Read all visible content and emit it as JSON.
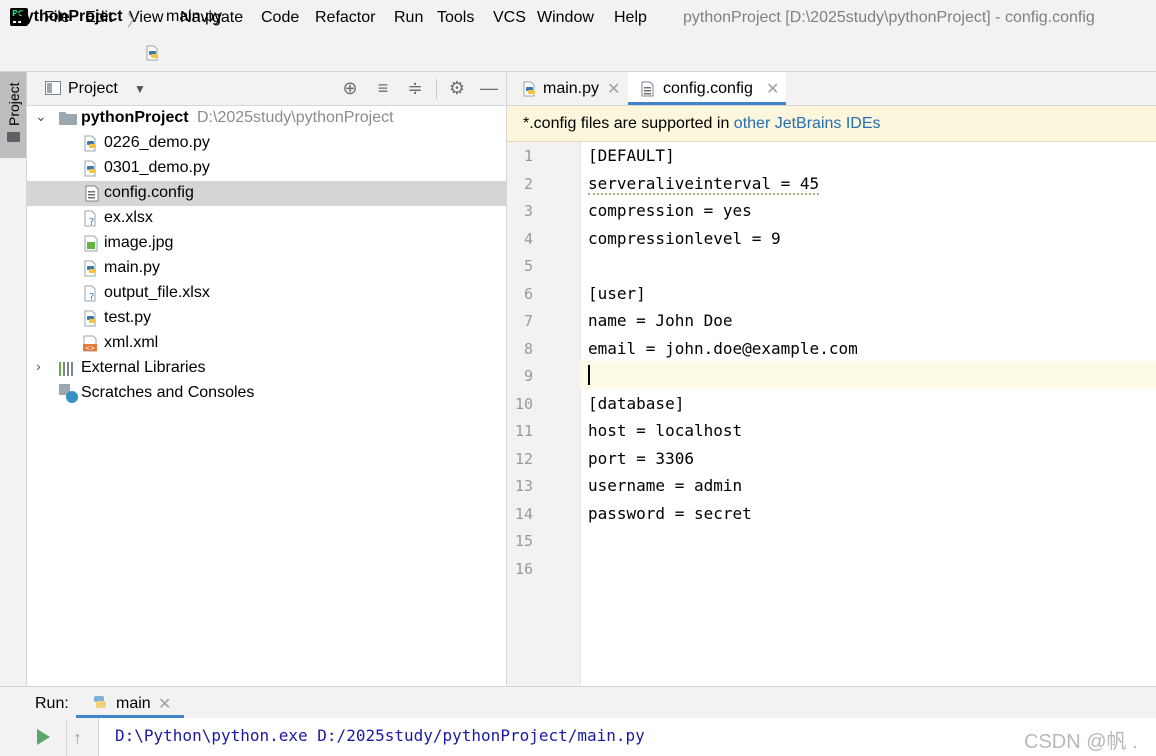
{
  "menubar": {
    "items": [
      "File",
      "Edit",
      "View",
      "Navigate",
      "Code",
      "Refactor",
      "Run",
      "Tools",
      "VCS",
      "Window",
      "Help"
    ],
    "window_title": "pythonProject [D:\\2025study\\pythonProject] - config.config"
  },
  "breadcrumb": {
    "project": "pythonProject",
    "file": "main.py"
  },
  "left_stripe": {
    "project_tab": "Project"
  },
  "project_panel": {
    "title": "Project",
    "root_name": "pythonProject",
    "root_path": "D:\\2025study\\pythonProject",
    "files": [
      {
        "name": "0226_demo.py",
        "icon": "python-file-icon"
      },
      {
        "name": "0301_demo.py",
        "icon": "python-file-icon"
      },
      {
        "name": "config.config",
        "icon": "text-file-icon",
        "selected": true
      },
      {
        "name": "ex.xlsx",
        "icon": "unknown-file-icon"
      },
      {
        "name": "image.jpg",
        "icon": "image-file-icon"
      },
      {
        "name": "main.py",
        "icon": "python-file-icon"
      },
      {
        "name": "output_file.xlsx",
        "icon": "unknown-file-icon"
      },
      {
        "name": "test.py",
        "icon": "python-file-icon"
      },
      {
        "name": "xml.xml",
        "icon": "xml-file-icon"
      }
    ],
    "external_libraries": "External Libraries",
    "scratches": "Scratches and Consoles"
  },
  "editor": {
    "tabs": [
      {
        "label": "main.py",
        "active": false
      },
      {
        "label": "config.config",
        "active": true
      }
    ],
    "banner_text": "*.config files are supported in ",
    "banner_link": "other JetBrains IDEs",
    "line_numbers": [
      "1",
      "2",
      "3",
      "4",
      "5",
      "6",
      "7",
      "8",
      "9",
      "10",
      "11",
      "12",
      "13",
      "14",
      "15",
      "16"
    ],
    "lines": [
      "[DEFAULT]",
      "serveraliveinterval = 45",
      "compression = yes",
      "compressionlevel = 9",
      "",
      "[user]",
      "name = John Doe",
      "email = john.doe@example.com",
      "",
      "[database]",
      "host = localhost",
      "port = 3306",
      "username = admin",
      "password = secret",
      "",
      ""
    ]
  },
  "run_panel": {
    "label": "Run:",
    "tab_label": "main",
    "output": "D:\\Python\\python.exe D:/2025study/pythonProject/main.py"
  },
  "watermark": "CSDN @帆 ."
}
